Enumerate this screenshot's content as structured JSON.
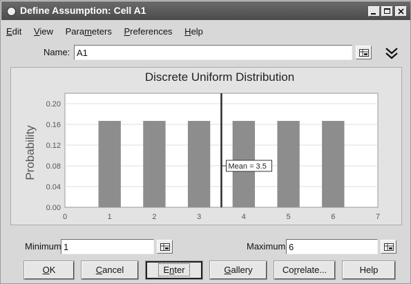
{
  "window": {
    "title": "Define Assumption: Cell A1",
    "controls": [
      "minimize",
      "maximize",
      "close"
    ]
  },
  "menu": [
    {
      "key": "E",
      "rest": "dit"
    },
    {
      "key": "V",
      "rest": "iew"
    },
    {
      "pre": "Para",
      "key": "m",
      "rest": "eters"
    },
    {
      "key": "P",
      "rest": "references"
    },
    {
      "key": "H",
      "rest": "elp"
    }
  ],
  "name_field": {
    "label": "Name:",
    "value": "A1"
  },
  "chart_data": {
    "type": "bar",
    "title": "Discrete Uniform Distribution",
    "ylabel": "Probability",
    "xlabel": "",
    "categories": [
      1,
      2,
      3,
      4,
      5,
      6
    ],
    "values": [
      0.1667,
      0.1667,
      0.1667,
      0.1667,
      0.1667,
      0.1667
    ],
    "xlim": [
      0,
      7
    ],
    "ylim": [
      0,
      0.22
    ],
    "x_ticks": [
      "0",
      "1",
      "2",
      "3",
      "4",
      "5",
      "6",
      "7"
    ],
    "y_ticks": [
      "0.00",
      "0.04",
      "0.08",
      "0.12",
      "0.16",
      "0.20"
    ],
    "y_tick_values": [
      0,
      0.04,
      0.08,
      0.12,
      0.16,
      0.2
    ],
    "mean_value": 3.5,
    "mean_label": "Mean = 3.5",
    "colors": {
      "bars": "#8d8d8d",
      "plot_bg": "#ffffff",
      "panel_bg": "#e3e3e3",
      "mean_line": "#2a2a2a"
    }
  },
  "minimum": {
    "label": "Minimum",
    "value": "1"
  },
  "maximum": {
    "label": "Maximum",
    "value": "6"
  },
  "buttons": [
    {
      "pre": "",
      "key": "O",
      "rest": "K"
    },
    {
      "pre": "",
      "key": "C",
      "rest": "ancel"
    },
    {
      "pre": "E",
      "key": "n",
      "rest": "ter"
    },
    {
      "pre": "",
      "key": "G",
      "rest": "allery"
    },
    {
      "pre": "Co",
      "key": "r",
      "rest": "relate..."
    },
    {
      "pre": "",
      "key": "",
      "rest": "Help"
    }
  ]
}
